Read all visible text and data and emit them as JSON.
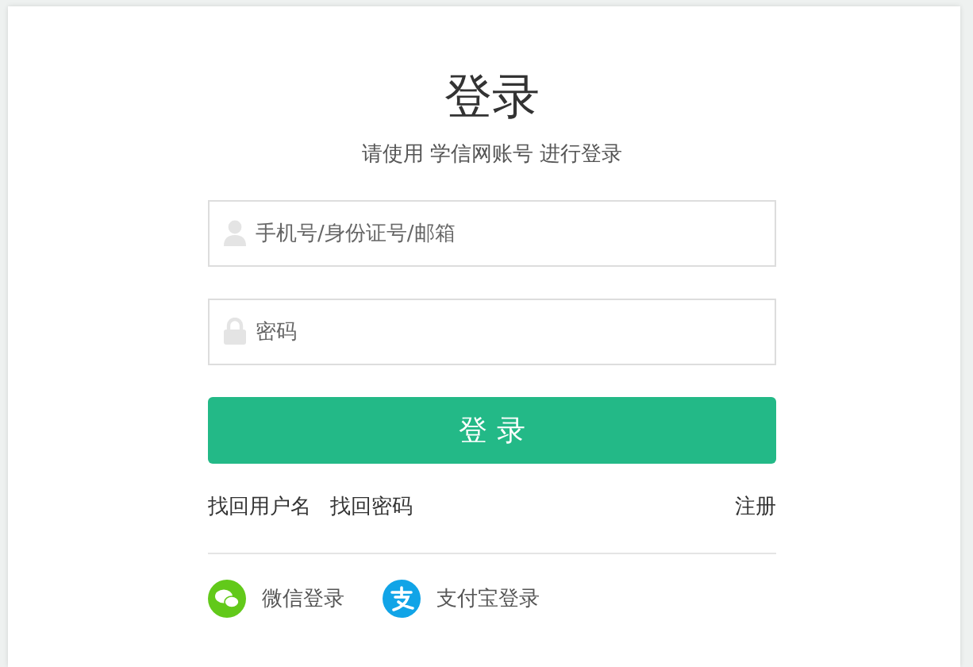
{
  "title": "登录",
  "subtitle": "请使用 学信网账号 进行登录",
  "fields": [
    {
      "kind": "user",
      "placeholder": "手机号/身份证号/邮箱"
    },
    {
      "kind": "lock",
      "placeholder": "密码"
    }
  ],
  "submit": "登 录",
  "links": {
    "left": [
      "找回用户名",
      "找回密码"
    ],
    "right": "注册"
  },
  "social": [
    {
      "kind": "wechat",
      "label": "微信登录"
    },
    {
      "kind": "alipay",
      "label": "支付宝登录"
    }
  ]
}
